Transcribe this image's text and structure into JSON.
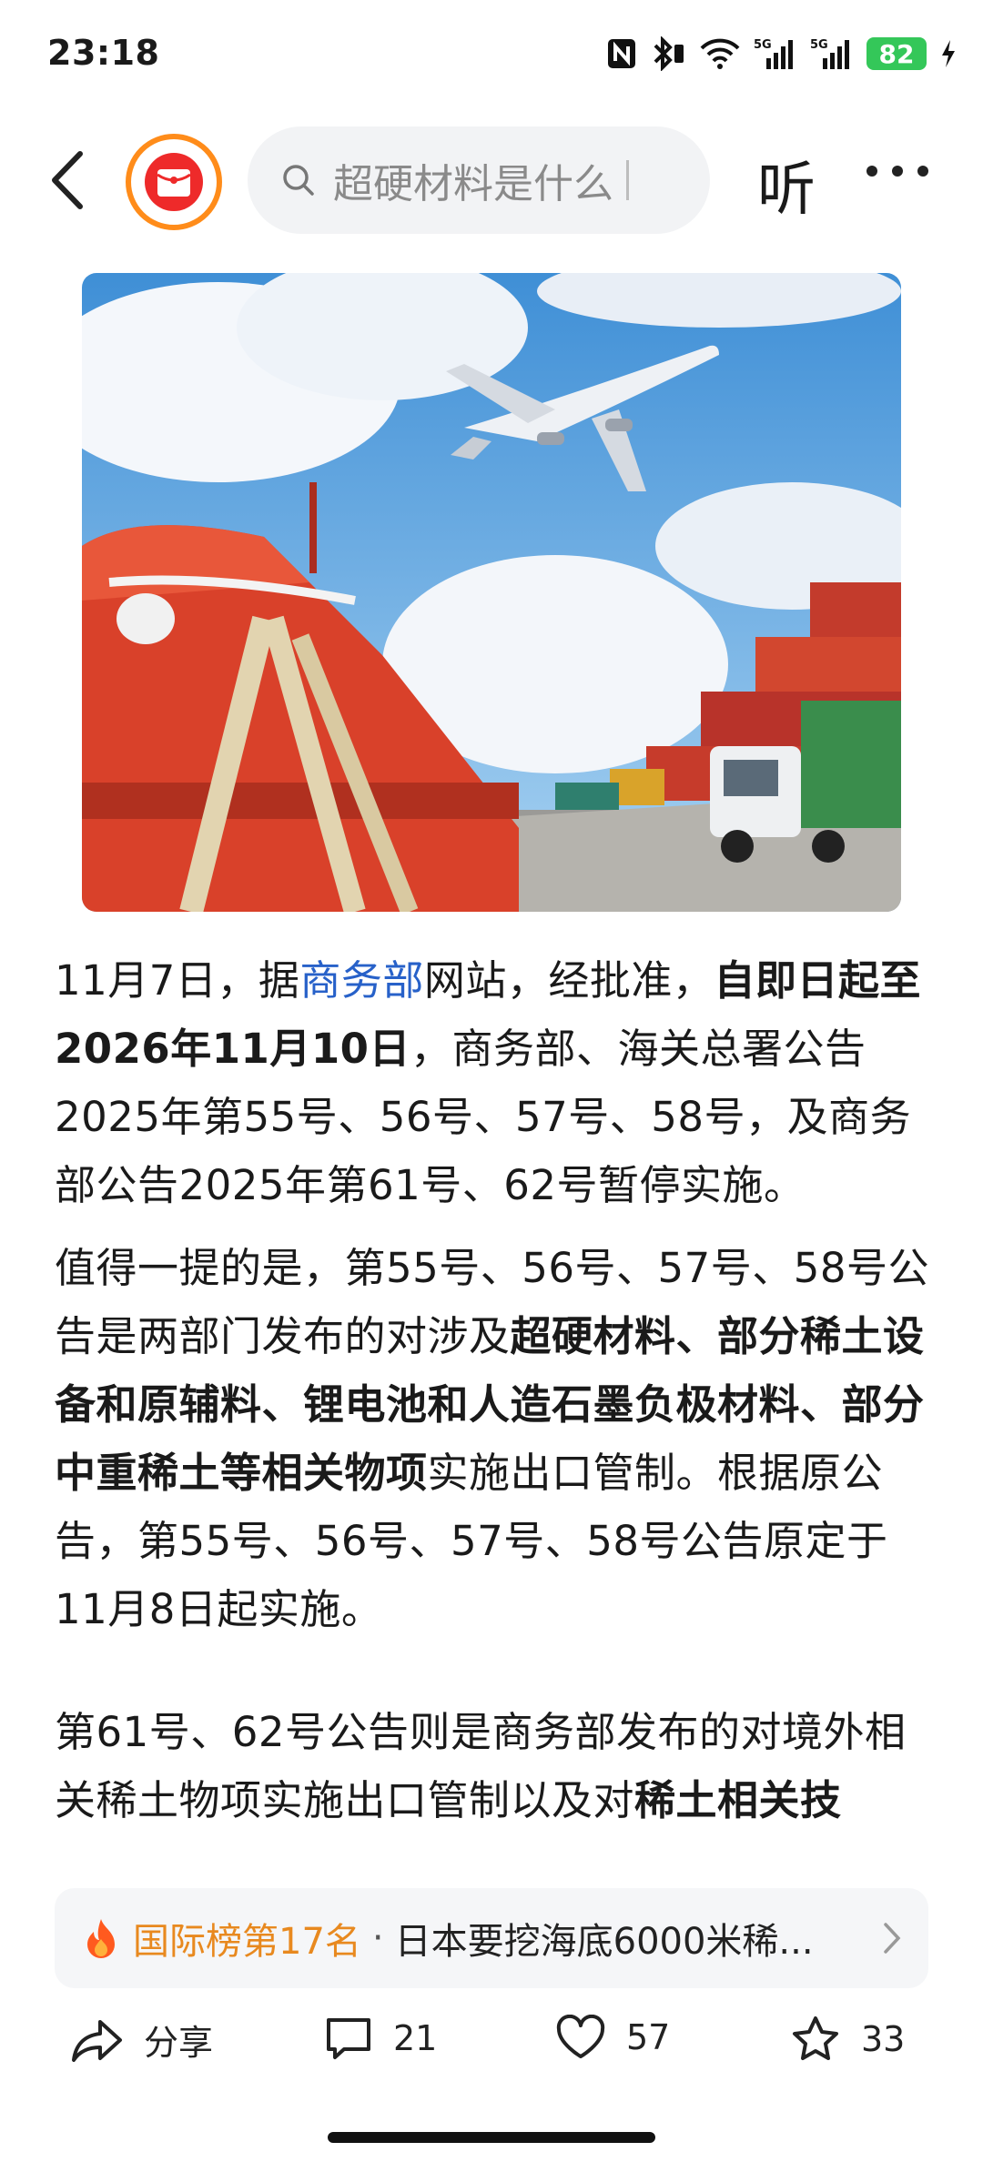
{
  "status": {
    "time": "23:18",
    "battery": "82",
    "icons": [
      "nfc-icon",
      "bluetooth-icon",
      "wifi-icon",
      "signal-5g-icon",
      "signal-5g-icon",
      "charging-icon"
    ]
  },
  "nav": {
    "search_placeholder": "超硬材料是什么",
    "listen_label": "听",
    "logo_icon": "red-packet-icon"
  },
  "article": {
    "p1": {
      "a": "11月7日，据",
      "link": "商务部",
      "b": "网站，经批准，",
      "bold": "自即日起至2026年11月10日",
      "c": "，商务部、海关总署公告2025年第55号、56号、57号、58号，及商务部公告2025年第61号、62号暂停实施。"
    },
    "p2": {
      "a": "值得一提的是，第55号、56号、57号、58号公告是两部门发布的对涉及",
      "bold": "超硬材料、部分稀土设备和原辅料、锂电池和人造石墨负极材料、部分中重稀土等相关物项",
      "c": "实施出口管制。根据原公告，第55号、56号、57号、58号公告原定于11月8日起实施。"
    },
    "p3": {
      "a": "第61号、62号公告则是商务部发布的对境外相关稀土物项实施出口管制以及对",
      "bold": "稀土相关技"
    }
  },
  "hotbar": {
    "rank": "国际榜第17名",
    "separator": "·",
    "title": "日本要挖海底6000米稀..."
  },
  "actions": {
    "share": "分享",
    "comments": "21",
    "likes": "57",
    "favorites": "33"
  },
  "colors": {
    "link": "#2761c9",
    "hot": "#e8891f",
    "logo_ring": "#ff8c1a",
    "battery": "#34c759"
  }
}
